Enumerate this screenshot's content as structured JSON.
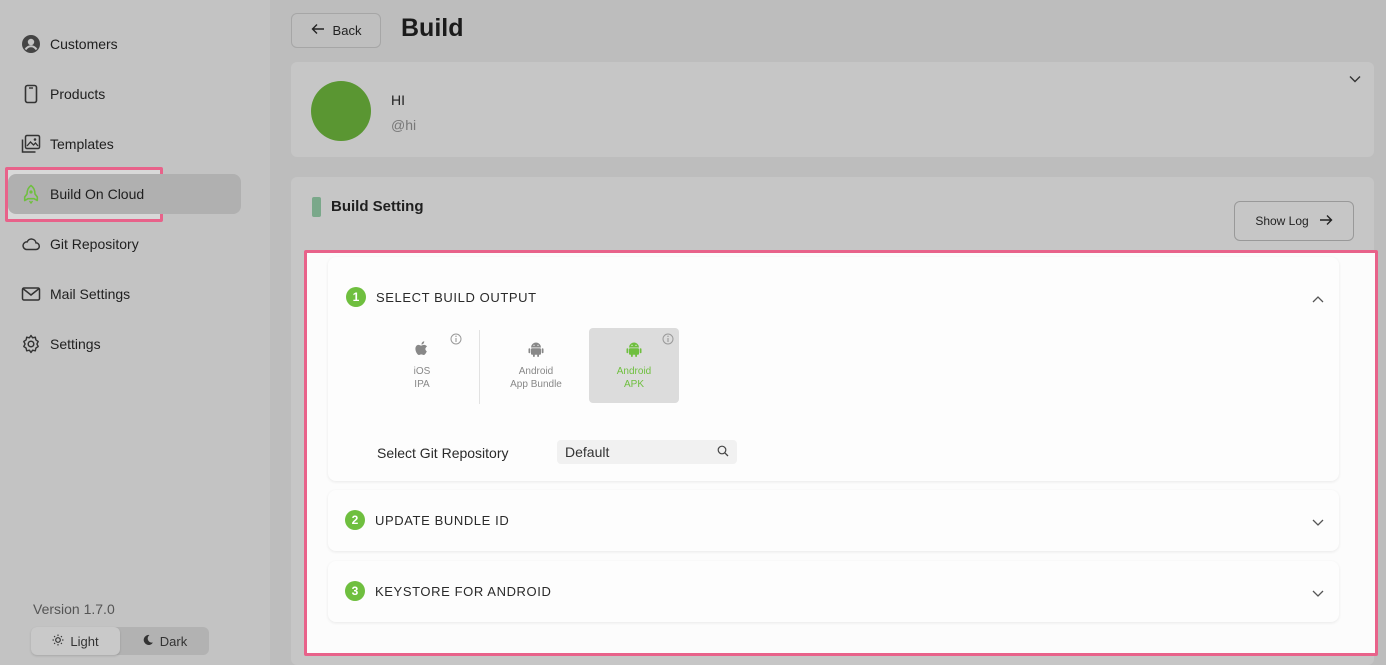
{
  "sidebar": {
    "items": [
      {
        "label": "Customers",
        "icon": "user-circle-icon"
      },
      {
        "label": "Products",
        "icon": "phone-icon"
      },
      {
        "label": "Templates",
        "icon": "image-stack-icon"
      },
      {
        "label": "Build On Cloud",
        "icon": "rocket-icon",
        "active": true
      },
      {
        "label": "Git Repository",
        "icon": "cloud-icon"
      },
      {
        "label": "Mail Settings",
        "icon": "mail-icon"
      },
      {
        "label": "Settings",
        "icon": "gear-icon"
      }
    ],
    "version": "Version 1.7.0",
    "theme": {
      "light": "Light",
      "dark": "Dark",
      "selected": "Light"
    }
  },
  "header": {
    "back_label": "Back",
    "title": "Build"
  },
  "profile": {
    "name": "HI",
    "handle": "@hi",
    "avatar_color": "#5a9632"
  },
  "build_setting": {
    "title": "Build Setting",
    "show_log_label": "Show Log",
    "steps": [
      {
        "number": "1",
        "title": "SELECT BUILD OUTPUT",
        "expanded": true,
        "options": [
          {
            "line1": "iOS",
            "line2": "IPA",
            "icon": "apple-icon",
            "selected": false
          },
          {
            "line1": "Android",
            "line2": "App Bundle",
            "icon": "android-icon",
            "selected": false
          },
          {
            "line1": "Android",
            "line2": "APK",
            "icon": "android-icon",
            "selected": true
          }
        ],
        "git_label": "Select Git Repository",
        "git_value": "Default"
      },
      {
        "number": "2",
        "title": "UPDATE BUNDLE ID",
        "expanded": false
      },
      {
        "number": "3",
        "title": "KEYSTORE FOR ANDROID",
        "expanded": false
      }
    ]
  },
  "colors": {
    "accent_green": "#6fbf3f",
    "highlight": "#e8628a"
  }
}
